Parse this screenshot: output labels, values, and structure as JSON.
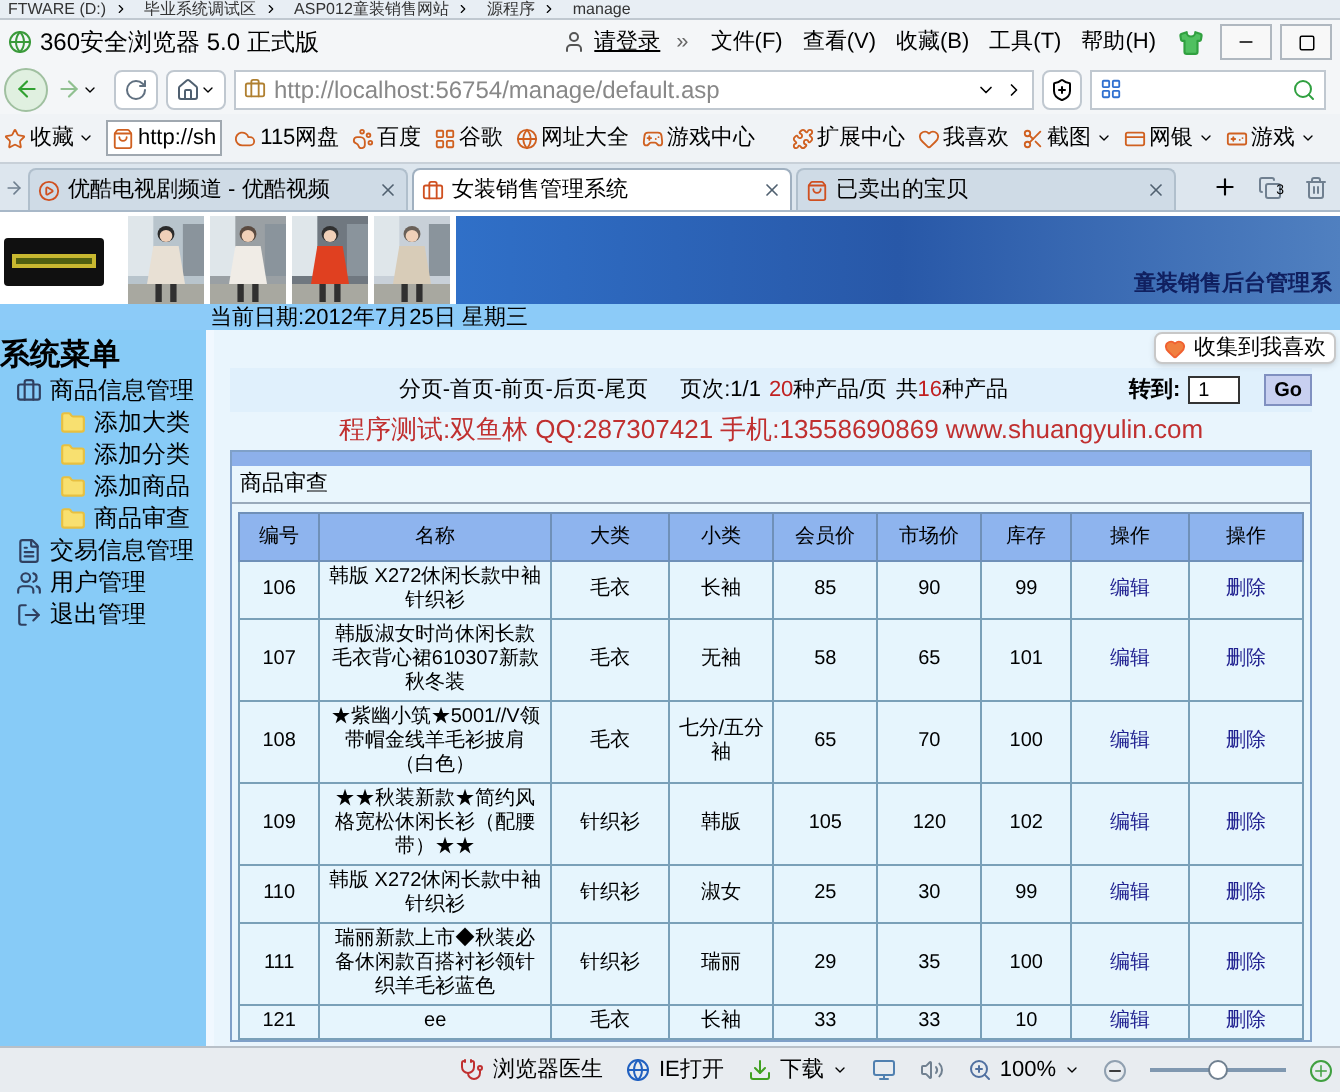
{
  "path_bar": {
    "crumbs": [
      "FTWARE (D:)",
      "毕业系统调试区",
      "ASP012童装销售网站",
      "源程序",
      "manage"
    ]
  },
  "window": {
    "title": "360安全浏览器 5.0 正式版",
    "login": "请登录",
    "more": "»",
    "menus": [
      "文件(F)",
      "查看(V)",
      "收藏(B)",
      "工具(T)",
      "帮助(H)"
    ]
  },
  "address": {
    "value": "http://localhost:56754/manage/default.asp"
  },
  "bookmarks": [
    {
      "label": "收藏"
    },
    {
      "label": "http://sh"
    },
    {
      "label": "115网盘"
    },
    {
      "label": "百度"
    },
    {
      "label": "谷歌"
    },
    {
      "label": "网址大全"
    },
    {
      "label": "游戏中心"
    },
    {
      "label": "扩展中心"
    },
    {
      "label": "我喜欢"
    },
    {
      "label": "截图"
    },
    {
      "label": "网银"
    },
    {
      "label": "游戏"
    }
  ],
  "tabs": [
    {
      "label": "优酷电视剧频道 - 优酷视频",
      "selected": false
    },
    {
      "label": "女装销售管理系统",
      "selected": true
    },
    {
      "label": "已卖出的宝贝",
      "selected": false
    }
  ],
  "tab_count": "3",
  "banner": {
    "title": "童装销售后台管理系"
  },
  "date": "当前日期:2012年7月25日 星期三",
  "sidebar": {
    "title": "系统菜单",
    "items": [
      {
        "label": "商品信息管理",
        "children": [
          {
            "label": "添加大类"
          },
          {
            "label": "添加分类"
          },
          {
            "label": "添加商品"
          },
          {
            "label": "商品审查"
          }
        ]
      },
      {
        "label": "交易信息管理"
      },
      {
        "label": "用户管理"
      },
      {
        "label": "退出管理"
      }
    ]
  },
  "favorite_button": "收集到我喜欢",
  "pager": {
    "links": "分页-首页-前页-后页-尾页",
    "page_label": "页次:",
    "page": "1/1",
    "per_page": "20",
    "per_page_unit": "种产品/页",
    "total_label": "共",
    "total": "16",
    "total_unit": "种产品",
    "goto_label": "转到:",
    "goto_value": "1",
    "go": "Go"
  },
  "contact": "程序测试:双鱼林 QQ:287307421 手机:13558690869 www.shuangyulin.com",
  "panel": {
    "title": "商品审查",
    "columns": [
      "编号",
      "名称",
      "大类",
      "小类",
      "会员价",
      "市场价",
      "库存",
      "操作",
      "操作"
    ],
    "rows": [
      {
        "cells": [
          "106",
          "韩版 X272休闲长款中袖针织衫",
          "毛衣",
          "长袖",
          "85",
          "90",
          "99"
        ],
        "actions": [
          "编辑",
          "删除"
        ]
      },
      {
        "cells": [
          "107",
          "韩版淑女时尚休闲长款毛衣背心裙610307新款秋冬装",
          "毛衣",
          "无袖",
          "58",
          "65",
          "101"
        ],
        "actions": [
          "编辑",
          "删除"
        ]
      },
      {
        "cells": [
          "108",
          "★紫幽小筑★5001//V领带帽金线羊毛衫披肩（白色）",
          "毛衣",
          "七分/五分袖",
          "65",
          "70",
          "100"
        ],
        "actions": [
          "编辑",
          "删除"
        ]
      },
      {
        "cells": [
          "109",
          "★★秋装新款★简约风格宽松休闲长衫（配腰带）★★",
          "针织衫",
          "韩版",
          "105",
          "120",
          "102"
        ],
        "actions": [
          "编辑",
          "删除"
        ]
      },
      {
        "cells": [
          "110",
          "韩版 X272休闲长款中袖针织衫",
          "针织衫",
          "淑女",
          "25",
          "30",
          "99"
        ],
        "actions": [
          "编辑",
          "删除"
        ]
      },
      {
        "cells": [
          "111",
          "瑞丽新款上市◆秋装必备休闲款百搭衬衫领针织羊毛衫蓝色",
          "针织衫",
          "瑞丽",
          "29",
          "35",
          "100"
        ],
        "actions": [
          "编辑",
          "删除"
        ]
      },
      {
        "cells": [
          "121",
          "ee",
          "毛衣",
          "长袖",
          "33",
          "33",
          "10"
        ],
        "actions": [
          "编辑",
          "删除"
        ]
      }
    ]
  },
  "status_bar": {
    "items": [
      "浏览器医生",
      "IE打开",
      "下载"
    ],
    "zoom": "100%",
    "zoom_slider": {
      "level": 0.5
    }
  }
}
